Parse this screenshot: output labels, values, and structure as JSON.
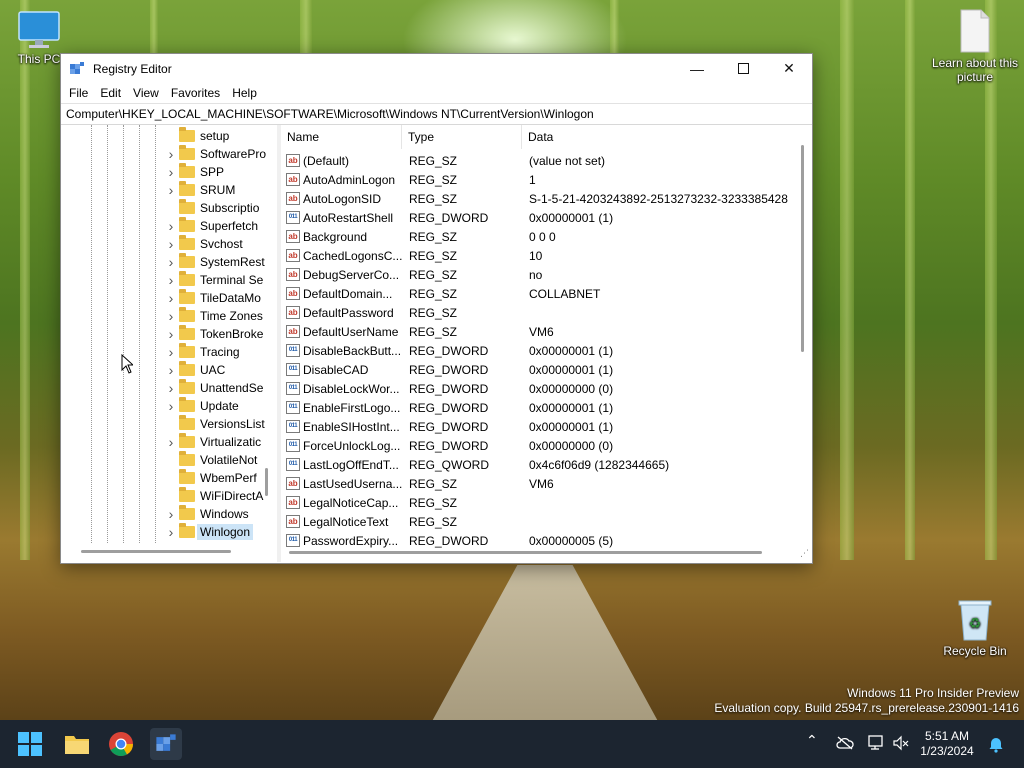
{
  "desktop": {
    "icons": [
      {
        "label": "This PC",
        "icon": "monitor-icon"
      },
      {
        "label": "Learn about this picture",
        "icon": "document-icon"
      },
      {
        "label": "Recycle Bin",
        "icon": "recycle-bin-icon"
      }
    ],
    "watermark": {
      "line1": "Windows 11 Pro Insider Preview",
      "line2": "Evaluation copy. Build 25947.rs_prerelease.230901-1416"
    }
  },
  "window": {
    "title": "Registry Editor",
    "menu": [
      "File",
      "Edit",
      "View",
      "Favorites",
      "Help"
    ],
    "address": "Computer\\HKEY_LOCAL_MACHINE\\SOFTWARE\\Microsoft\\Windows NT\\CurrentVersion\\Winlogon",
    "tree": [
      {
        "label": "setup",
        "expandable": false
      },
      {
        "label": "SoftwarePro",
        "expandable": true
      },
      {
        "label": "SPP",
        "expandable": true
      },
      {
        "label": "SRUM",
        "expandable": true
      },
      {
        "label": "Subscriptio",
        "expandable": false
      },
      {
        "label": "Superfetch",
        "expandable": true
      },
      {
        "label": "Svchost",
        "expandable": true
      },
      {
        "label": "SystemRest",
        "expandable": true
      },
      {
        "label": "Terminal Se",
        "expandable": true
      },
      {
        "label": "TileDataMo",
        "expandable": true
      },
      {
        "label": "Time Zones",
        "expandable": true
      },
      {
        "label": "TokenBroke",
        "expandable": true
      },
      {
        "label": "Tracing",
        "expandable": true
      },
      {
        "label": "UAC",
        "expandable": true
      },
      {
        "label": "UnattendSe",
        "expandable": true
      },
      {
        "label": "Update",
        "expandable": true
      },
      {
        "label": "VersionsList",
        "expandable": false
      },
      {
        "label": "Virtualizatic",
        "expandable": true
      },
      {
        "label": "VolatileNot",
        "expandable": false
      },
      {
        "label": "WbemPerf",
        "expandable": false
      },
      {
        "label": "WiFiDirectA",
        "expandable": false
      },
      {
        "label": "Windows",
        "expandable": true
      },
      {
        "label": "Winlogon",
        "expandable": true,
        "selected": true
      }
    ],
    "columns": {
      "name": "Name",
      "type": "Type",
      "data": "Data"
    },
    "values": [
      {
        "name": "(Default)",
        "type": "REG_SZ",
        "data": "(value not set)",
        "icon": "string-value-icon"
      },
      {
        "name": "AutoAdminLogon",
        "type": "REG_SZ",
        "data": "1",
        "icon": "string-value-icon"
      },
      {
        "name": "AutoLogonSID",
        "type": "REG_SZ",
        "data": "S-1-5-21-4203243892-2513273232-3233385428",
        "icon": "string-value-icon"
      },
      {
        "name": "AutoRestartShell",
        "type": "REG_DWORD",
        "data": "0x00000001 (1)",
        "icon": "binary-value-icon"
      },
      {
        "name": "Background",
        "type": "REG_SZ",
        "data": "0 0 0",
        "icon": "string-value-icon"
      },
      {
        "name": "CachedLogonsC...",
        "type": "REG_SZ",
        "data": "10",
        "icon": "string-value-icon"
      },
      {
        "name": "DebugServerCo...",
        "type": "REG_SZ",
        "data": "no",
        "icon": "string-value-icon"
      },
      {
        "name": "DefaultDomain...",
        "type": "REG_SZ",
        "data": "COLLABNET",
        "icon": "string-value-icon"
      },
      {
        "name": "DefaultPassword",
        "type": "REG_SZ",
        "data": "",
        "icon": "string-value-icon"
      },
      {
        "name": "DefaultUserName",
        "type": "REG_SZ",
        "data": "VM6",
        "icon": "string-value-icon"
      },
      {
        "name": "DisableBackButt...",
        "type": "REG_DWORD",
        "data": "0x00000001 (1)",
        "icon": "binary-value-icon"
      },
      {
        "name": "DisableCAD",
        "type": "REG_DWORD",
        "data": "0x00000001 (1)",
        "icon": "binary-value-icon"
      },
      {
        "name": "DisableLockWor...",
        "type": "REG_DWORD",
        "data": "0x00000000 (0)",
        "icon": "binary-value-icon"
      },
      {
        "name": "EnableFirstLogo...",
        "type": "REG_DWORD",
        "data": "0x00000001 (1)",
        "icon": "binary-value-icon"
      },
      {
        "name": "EnableSIHostInt...",
        "type": "REG_DWORD",
        "data": "0x00000001 (1)",
        "icon": "binary-value-icon"
      },
      {
        "name": "ForceUnlockLog...",
        "type": "REG_DWORD",
        "data": "0x00000000 (0)",
        "icon": "binary-value-icon"
      },
      {
        "name": "LastLogOffEndT...",
        "type": "REG_QWORD",
        "data": "0x4c6f06d9 (1282344665)",
        "icon": "binary-value-icon"
      },
      {
        "name": "LastUsedUserna...",
        "type": "REG_SZ",
        "data": "VM6",
        "icon": "string-value-icon"
      },
      {
        "name": "LegalNoticeCap...",
        "type": "REG_SZ",
        "data": "",
        "icon": "string-value-icon"
      },
      {
        "name": "LegalNoticeText",
        "type": "REG_SZ",
        "data": "",
        "icon": "string-value-icon"
      },
      {
        "name": "PasswordExpiry...",
        "type": "REG_DWORD",
        "data": "0x00000005 (5)",
        "icon": "binary-value-icon"
      }
    ]
  },
  "taskbar": {
    "apps": [
      "start-icon",
      "file-explorer-icon",
      "chrome-icon",
      "registry-editor-icon"
    ],
    "tray": [
      "chevron-up-icon",
      "cloud-off-icon",
      "network-icon",
      "volume-mute-icon",
      "notification-bell-icon"
    ],
    "time": "5:51 AM",
    "date": "1/23/2024"
  }
}
